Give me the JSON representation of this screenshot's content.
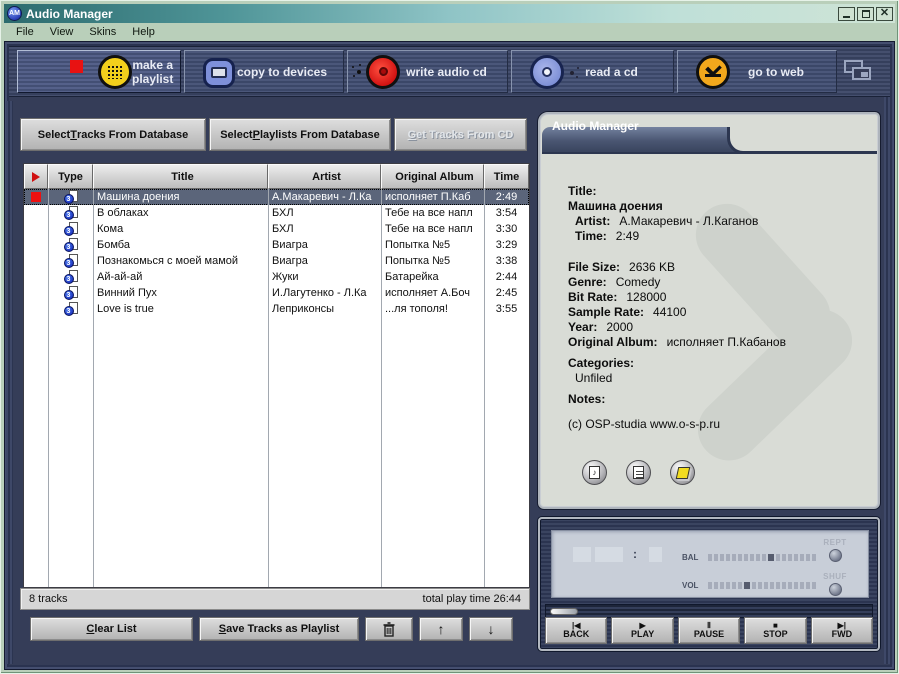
{
  "window": {
    "title": "Audio Manager",
    "icon_text": "AM"
  },
  "menu": {
    "items": [
      "File",
      "View",
      "Skins",
      "Help"
    ]
  },
  "toolbar": {
    "buttons": [
      {
        "label": "make a playlist"
      },
      {
        "label": "copy to devices"
      },
      {
        "label": "write audio cd"
      },
      {
        "label": "read a cd"
      },
      {
        "label": "go to web"
      }
    ]
  },
  "db_buttons": [
    {
      "pre": "Select ",
      "key": "T",
      "post": "racks From Database",
      "disabled": false
    },
    {
      "pre": "Select ",
      "key": "P",
      "post": "laylists From Database",
      "disabled": false
    },
    {
      "pre": "",
      "key": "G",
      "post": "et Tracks From CD",
      "disabled": true
    }
  ],
  "table": {
    "headers": {
      "type": "Type",
      "title": "Title",
      "artist": "Artist",
      "album": "Original Album",
      "time": "Time"
    },
    "rows": [
      {
        "title": "Машина доения",
        "artist": "А.Макаревич - Л.Ка",
        "album": "исполняет П.Каб",
        "time": "2:49"
      },
      {
        "title": "В облаках",
        "artist": "БХЛ",
        "album": "Тебе на все напл",
        "time": "3:54"
      },
      {
        "title": "Кома",
        "artist": "БХЛ",
        "album": "Тебе на все напл",
        "time": "3:30"
      },
      {
        "title": "Бомба",
        "artist": "Виагра",
        "album": "Попытка №5",
        "time": "3:29"
      },
      {
        "title": "Познакомься с моей мамой",
        "artist": "Виагра",
        "album": "Попытка №5",
        "time": "3:38"
      },
      {
        "title": "Ай-ай-ай",
        "artist": "Жуки",
        "album": "Батарейка",
        "time": "2:44"
      },
      {
        "title": "Винний Пух",
        "artist": "И.Лагутенко - Л.Ка",
        "album": "исполняет А.Боч",
        "time": "2:45"
      },
      {
        "title": "Love is true",
        "artist": "Леприконсы",
        "album": "...ля тополя!",
        "time": "3:55"
      }
    ],
    "status_left": "8 tracks",
    "status_right": "total play time 26:44"
  },
  "actions": {
    "clear": {
      "pre": "",
      "key": "C",
      "post": "lear List"
    },
    "save": {
      "pre": "",
      "key": "S",
      "post": "ave Tracks as Playlist"
    },
    "up_glyph": "↑",
    "down_glyph": "↓"
  },
  "info": {
    "panel_title": "Audio Manager",
    "title_label": "Title:",
    "title_value": "Машина доения",
    "artist_label": "Artist:",
    "artist_value": "А.Макаревич - Л.Каганов",
    "time_label": "Time:",
    "time_value": "2:49",
    "filesize_label": "File Size:",
    "filesize_value": "2636 KB",
    "genre_label": "Genre:",
    "genre_value": "Comedy",
    "bitrate_label": "Bit Rate:",
    "bitrate_value": "128000",
    "samplerate_label": "Sample Rate:",
    "samplerate_value": "44100",
    "year_label": "Year:",
    "year_value": "2000",
    "album_label": "Original Album:",
    "album_value": "исполняет П.Кабанов",
    "categories_label": "Categories:",
    "categories_value": "Unfiled",
    "notes_label": "Notes:",
    "notes_value": "(c) OSP-studia www.o-s-p.ru"
  },
  "player": {
    "lcd_colon": ":",
    "bal_label": "BAL",
    "vol_label": "VOL",
    "rept_label": "REPT",
    "shuf_label": "SHUF",
    "bal_pos": 0.6,
    "vol_pos": 0.35,
    "tick_count": 18,
    "buttons": [
      {
        "glyph": "|◀",
        "label": "BACK"
      },
      {
        "glyph": "▶",
        "label": "PLAY"
      },
      {
        "glyph": "Ⅱ",
        "label": "PAUSE"
      },
      {
        "glyph": "■",
        "label": "STOP"
      },
      {
        "glyph": "▶|",
        "label": "FWD"
      }
    ]
  },
  "colors": {
    "titlebar_teal": "#2c6b6e",
    "menubar_green": "#b9cfba",
    "app_navy": "#353d58",
    "accent_red": "#e81212",
    "selection_grey": "#5b657a",
    "panel_header_slate": "#4a5672",
    "lcd_grey": "#c8ced8",
    "icon_yellow": "#f2cf1c",
    "icon_red": "#cf0f0f",
    "icon_blue": "#7c8ed6",
    "icon_orange": "#f2a81c"
  }
}
